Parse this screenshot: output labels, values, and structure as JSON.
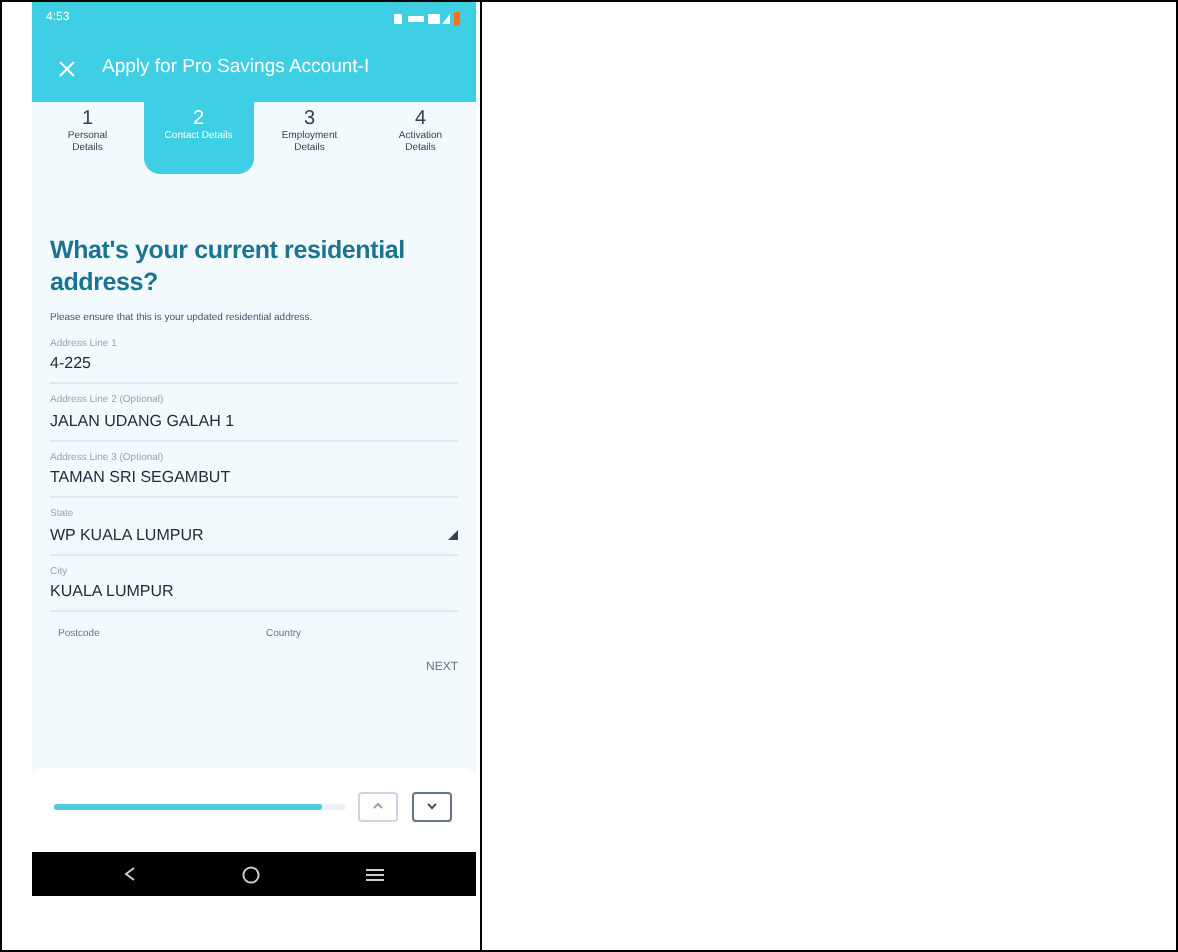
{
  "status_bar": {
    "time": "4:53"
  },
  "header": {
    "title": "Apply for Pro Savings Account-I"
  },
  "steps": [
    {
      "number": "1",
      "label": "Personal Details",
      "selected": false
    },
    {
      "number": "2",
      "label": "Contact Details",
      "selected": true
    },
    {
      "number": "3",
      "label": "Employment Details",
      "selected": false
    },
    {
      "number": "4",
      "label": "Activation Details",
      "selected": false
    }
  ],
  "heading": "What's your current residential address?",
  "note": "Please ensure that this is your updated residential address.",
  "fields": [
    {
      "kind": "text",
      "label": "Address Line 1",
      "value": "4-225"
    },
    {
      "kind": "text",
      "label": "Address Line 2 (Optional)",
      "value": "JALAN UDANG GALAH 1"
    },
    {
      "kind": "text",
      "label": "Address Line 3 (Optional)",
      "value": "TAMAN SRI SEGAMBUT"
    },
    {
      "kind": "select",
      "label": "State",
      "value": "WP KUALA LUMPUR"
    },
    {
      "kind": "text",
      "label": "City",
      "value": "KUALA LUMPUR"
    }
  ],
  "half_fields": [
    {
      "label": "Postcode"
    },
    {
      "label": "Country"
    }
  ],
  "next_button": "NEXT",
  "progress": {
    "level": 0.92
  }
}
